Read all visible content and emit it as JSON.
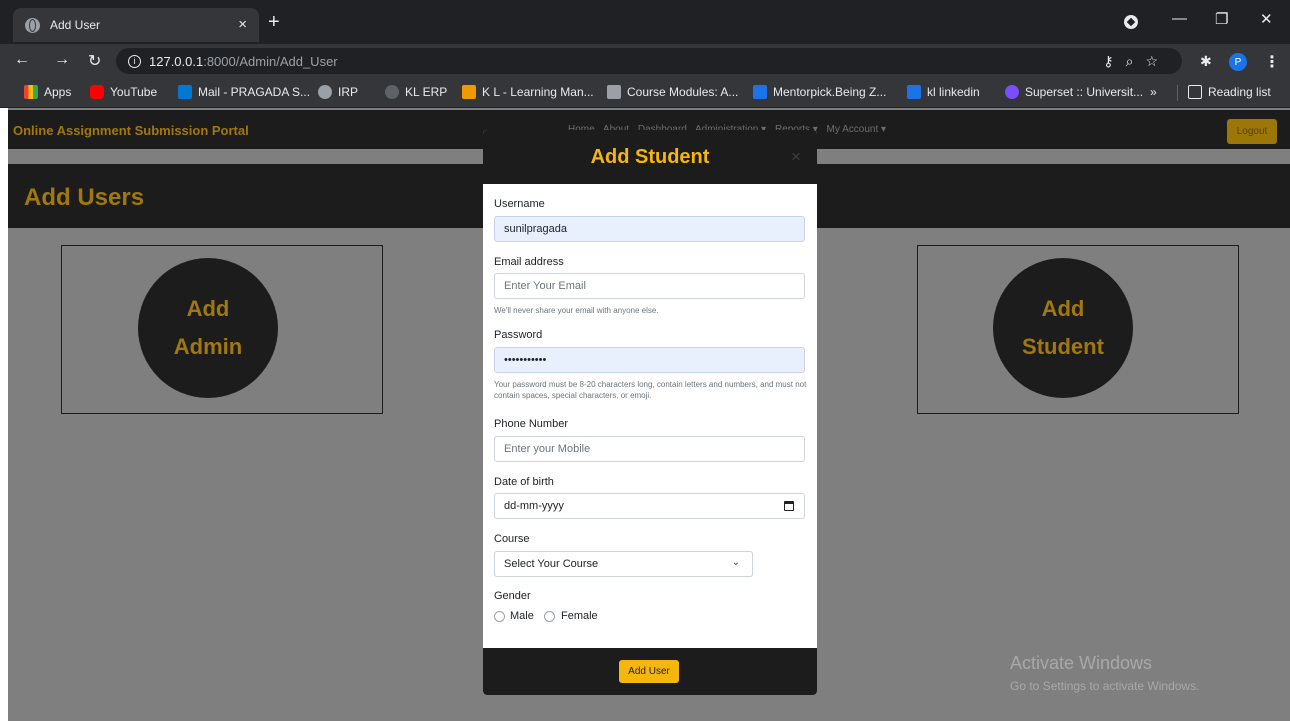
{
  "browser": {
    "tab_title": "Add User",
    "tab_close": "×",
    "new_tab": "+",
    "url_host": "127.0.0.1",
    "url_rest": ":8000/Admin/Add_User",
    "profile_initial": "P",
    "bookmarks": [
      {
        "label": "Apps",
        "color": "#ea4335"
      },
      {
        "label": "YouTube",
        "color": "#ff0000"
      },
      {
        "label": "Mail - PRAGADA S...",
        "color": "#0078d4"
      },
      {
        "label": "IRP",
        "color": "#9aa0a6"
      },
      {
        "label": "KL ERP",
        "color": "#5f6368"
      },
      {
        "label": "K L - Learning Man...",
        "color": "#f29900"
      },
      {
        "label": "Course Modules: A...",
        "color": "#9aa0a6"
      },
      {
        "label": "Mentorpick.Being Z...",
        "color": "#1a73e8"
      },
      {
        "label": "kl linkedin",
        "color": "#1a73e8"
      },
      {
        "label": "Superset :: Universit...",
        "color": "#7c4dff"
      }
    ],
    "more_bookmarks": "»",
    "reading_list": "Reading list"
  },
  "navbar": {
    "brand": "Online Assignment Submission Portal",
    "links": [
      "Home",
      "About",
      "Dashboard",
      "Administration ▾",
      "Reports ▾",
      "My Account ▾"
    ],
    "logout": "Logout"
  },
  "page": {
    "title": "Add Users",
    "add_admin_line1": "Add",
    "add_admin_line2": "Admin",
    "add_student_line1": "Add",
    "add_student_line2": "Student"
  },
  "modal": {
    "title": "Add Student",
    "close": "×",
    "username_label": "Username",
    "username_value": "sunilpragada",
    "email_label": "Email address",
    "email_placeholder": "Enter Your Email",
    "email_help": "We'll never share your email with anyone else.",
    "password_label": "Password",
    "password_value": "•••••••••••",
    "password_help": "Your password must be 8-20 characters long, contain letters and numbers, and must not contain spaces, special characters, or emoji.",
    "phone_label": "Phone Number",
    "phone_placeholder": "Enter your Mobile",
    "dob_label": "Date of birth",
    "dob_placeholder": "dd-mm-yyyy",
    "course_label": "Course",
    "course_selected": "Select Your Course",
    "gender_label": "Gender",
    "gender_male": "Male",
    "gender_female": "Female",
    "submit": "Add User"
  },
  "watermark": {
    "line1": "Activate Windows",
    "line2": "Go to Settings to activate Windows."
  },
  "colors": {
    "accent": "#f5b60d",
    "dark": "#1c1c1c"
  }
}
